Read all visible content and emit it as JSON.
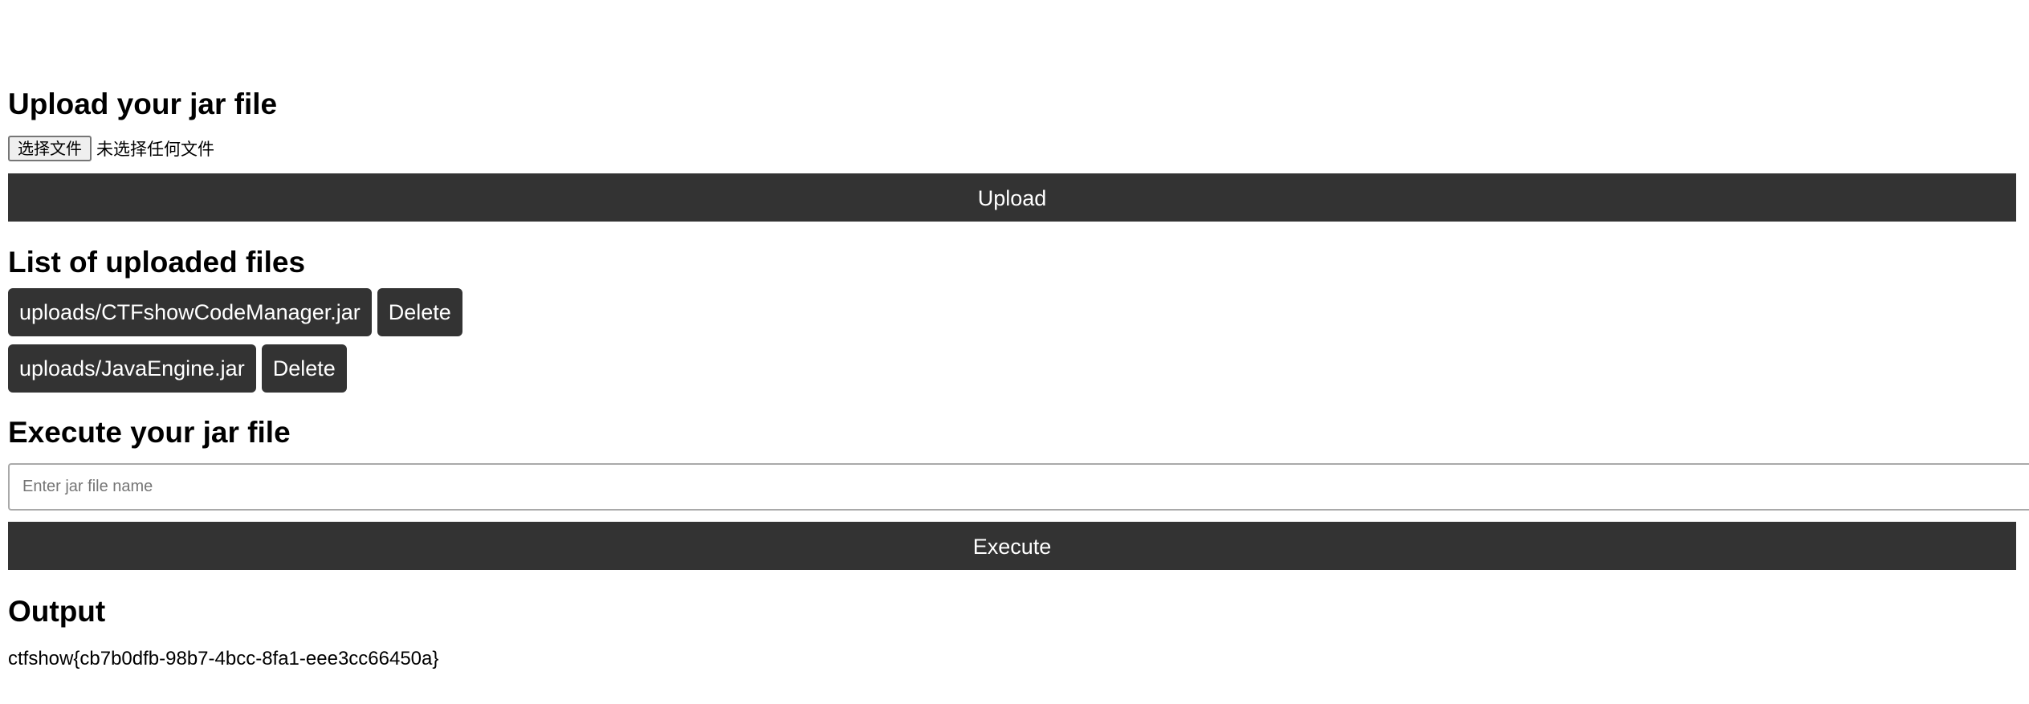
{
  "upload": {
    "heading": "Upload your jar file",
    "choose_button": "选择文件",
    "no_file_text": "未选择任何文件",
    "upload_button": "Upload"
  },
  "files": {
    "heading": "List of uploaded files",
    "items": [
      {
        "path": "uploads/CTFshowCodeManager.jar",
        "delete_label": "Delete"
      },
      {
        "path": "uploads/JavaEngine.jar",
        "delete_label": "Delete"
      }
    ]
  },
  "execute": {
    "heading": "Execute your jar file",
    "input_value": "",
    "input_placeholder": "Enter jar file name",
    "execute_button": "Execute"
  },
  "output": {
    "heading": "Output",
    "text": "ctfshow{cb7b0dfb-98b7-4bcc-8fa1-eee3cc66450a}"
  },
  "colors": {
    "button_bg": "#333333",
    "button_text": "#ffffff"
  }
}
